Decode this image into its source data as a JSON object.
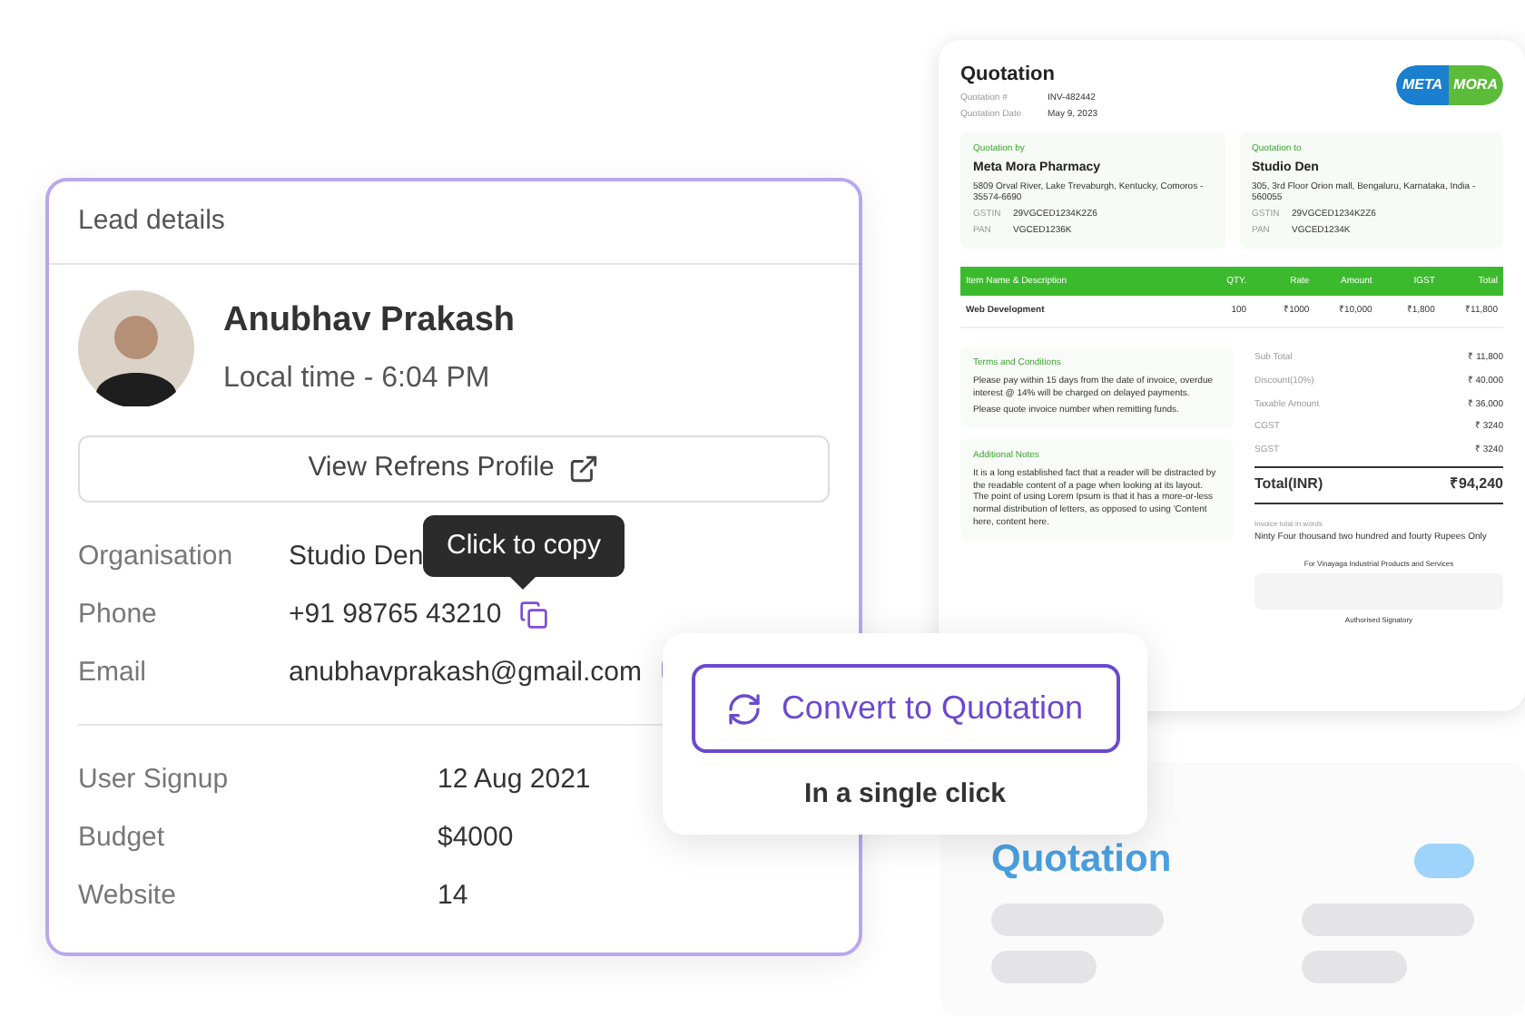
{
  "quotation_doc": {
    "title": "Quotation",
    "meta": [
      {
        "label": "Quotation #",
        "value": "INV-482442"
      },
      {
        "label": "Quotation Date",
        "value": "May 9, 2023"
      }
    ],
    "logo": [
      "META",
      "MORA"
    ],
    "parties": [
      {
        "label": "Quotation by",
        "name": "Meta Mora Pharmacy",
        "address": "5809 Orval River, Lake Trevaburgh, Kentucky, Comoros - 35574-6690",
        "gstin_label": "GSTIN",
        "gstin": "29VGCED1234K2Z6",
        "pan_label": "PAN",
        "pan": "VGCED1236K"
      },
      {
        "label": "Quotation to",
        "name": "Studio Den",
        "address": "305, 3rd Floor Orion mall, Bengaluru, Karnataka, India - 560055",
        "gstin_label": "GSTIN",
        "gstin": "29VGCED1234K2Z6",
        "pan_label": "PAN",
        "pan": "VGCED1234K"
      }
    ],
    "table": {
      "columns": [
        "Item Name & Description",
        "QTY.",
        "Rate",
        "Amount",
        "IGST",
        "Total"
      ],
      "rows": [
        [
          "Web Development",
          "100",
          "₹1000",
          "₹10,000",
          "₹1,800",
          "₹11,800"
        ]
      ]
    },
    "notes": [
      {
        "title": "Terms and Conditions",
        "paragraphs": [
          "Please pay within 15 days from the date of invoice, overdue interest @ 14% will be charged on delayed payments.",
          "Please quote invoice number when remitting funds."
        ]
      },
      {
        "title": "Additional Notes",
        "paragraphs": [
          "It is a long established fact that a reader will be distracted by the readable content of a page when looking at its layout. The point of using Lorem Ipsum is that it has a more-or-less normal distribution of letters, as opposed to using 'Content here, content here."
        ]
      }
    ],
    "totals": [
      {
        "label": "Sub Total",
        "value": "₹ 11,800"
      },
      {
        "label": "Discount(10%)",
        "value": "₹ 40,000"
      },
      {
        "label": "Taxable Amount",
        "value": "₹ 36,000"
      },
      {
        "label": "CGST",
        "value": "₹ 3240"
      },
      {
        "label": "SGST",
        "value": "₹ 3240"
      }
    ],
    "grand_total": {
      "label": "Total(INR)",
      "value": "₹94,240"
    },
    "words_label": "Invoice total in words",
    "words": "Ninty Four thousand two hundred and fourty Rupees Only",
    "for_line": "For Vinayaga Industrial Products and Services",
    "signatory": "Authorised Signatory"
  },
  "lead": {
    "title": "Lead details",
    "name": "Anubhav Prakash",
    "local_time": "Local time - 6:04 PM",
    "profile_button": "View Refrens Profile",
    "contact": [
      {
        "kind": "plain",
        "label": "Organisation",
        "value": "Studio Den"
      },
      {
        "kind": "copyable",
        "label": "Phone",
        "value": "+91 98765 43210"
      },
      {
        "kind": "copyable",
        "label": "Email",
        "value": "anubhavprakash@gmail.com"
      }
    ],
    "details": [
      {
        "label": "User Signup",
        "value": "12 Aug 2021"
      },
      {
        "label": "Budget",
        "value": "$4000"
      },
      {
        "label": "Website",
        "value": "14"
      }
    ],
    "tooltip": "Click to copy"
  },
  "convert": {
    "button": "Convert to Quotation",
    "caption": "In a single click"
  },
  "faded_doc": {
    "title": "Quotation"
  }
}
